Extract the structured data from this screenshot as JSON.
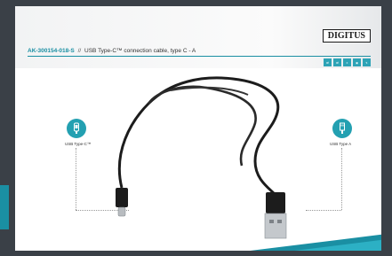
{
  "header": {
    "article_code": "AK-300154-018-S",
    "separator": "//",
    "description": "USB Type-C™ connection cable, type C - A",
    "brand": "DIGITUS"
  },
  "connectors": {
    "left_label": "USB Type-C™",
    "right_label": "USB Type A"
  },
  "badges": [
    "icon-1",
    "icon-2",
    "icon-3",
    "icon-4",
    "icon-5"
  ],
  "colors": {
    "accent": "#1a8fa3",
    "background_dark": "#3a4047",
    "cable": "#1c1c1c"
  }
}
